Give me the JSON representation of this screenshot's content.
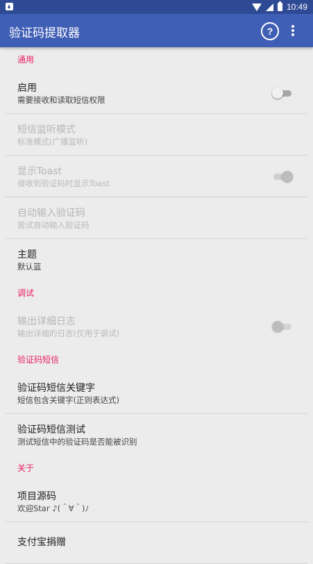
{
  "status_bar": {
    "time": "10:49"
  },
  "app_bar": {
    "title": "验证码提取器",
    "help_label": "?"
  },
  "sections": [
    {
      "category": "通用",
      "items": [
        {
          "title": "启用",
          "summary": "需要接收和读取短信权限",
          "switch": "off",
          "enabled": true
        },
        {
          "title": "短信监听模式",
          "summary": "标准模式(广播监听)",
          "enabled": false
        },
        {
          "title": "显示Toast",
          "summary": "接收到验证码时显示Toast",
          "switch": "on",
          "enabled": false
        },
        {
          "title": "自动输入验证码",
          "summary": "尝试自动输入验证码",
          "enabled": false
        },
        {
          "title": "主题",
          "summary": "默认蓝",
          "enabled": true
        }
      ]
    },
    {
      "category": "调试",
      "items": [
        {
          "title": "输出详细日志",
          "summary": "输出详细的日志(仅用于调试)",
          "switch": "off",
          "enabled": false
        }
      ]
    },
    {
      "category": "验证码短信",
      "items": [
        {
          "title": "验证码短信关键字",
          "summary": "短信包含关键字(正则表达式)",
          "enabled": true
        },
        {
          "title": "验证码短信测试",
          "summary": "测试短信中的验证码是否能被识别",
          "enabled": true
        }
      ]
    },
    {
      "category": "关于",
      "items": [
        {
          "title": "项目源码",
          "summary": "欢迎Star ♪(＾∀＾)ﾉ",
          "enabled": true
        },
        {
          "title": "支付宝捐赠",
          "summary": "",
          "enabled": true
        }
      ]
    }
  ]
}
